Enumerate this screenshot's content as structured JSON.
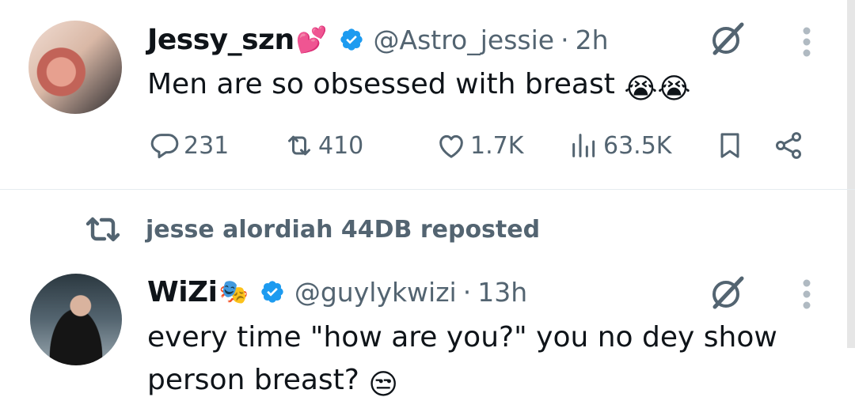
{
  "tweets": [
    {
      "name": "Jessy_szn",
      "name_emoji": "💕",
      "handle": "@Astro_jessie",
      "separator": "·",
      "time": "2h",
      "text": "Men are so obsessed with breast",
      "text_emoji": "😭😭",
      "stats": {
        "replies": "231",
        "reposts": "410",
        "likes": "1.7K",
        "views": "63.5K"
      }
    },
    {
      "repost_label": "jesse alordiah 44DB reposted",
      "name": "WiZi",
      "name_emoji": "🎭",
      "handle": "@guylykwizi",
      "separator": "·",
      "time": "13h",
      "text": "every time \"how are you?\" you no dey show person breast?",
      "text_emoji": "😒"
    }
  ],
  "colors": {
    "verified": "#1d9bf0",
    "secondary_text": "#536471",
    "divider": "#e6ecf0"
  },
  "icons": [
    "verified-badge-icon",
    "grok-icon",
    "more-icon",
    "reply-icon",
    "repost-icon",
    "like-icon",
    "views-icon",
    "bookmark-icon",
    "share-icon"
  ]
}
